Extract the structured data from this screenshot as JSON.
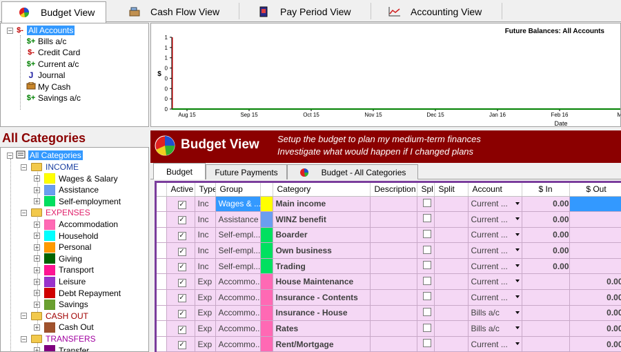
{
  "view_tabs": [
    {
      "label": "Budget View",
      "icon": "pie-chart-icon"
    },
    {
      "label": "Cash Flow View",
      "icon": "cash-register-icon"
    },
    {
      "label": "Pay Period View",
      "icon": "calendar-book-icon"
    },
    {
      "label": "Accounting View",
      "icon": "line-graph-icon"
    }
  ],
  "accounts": {
    "root": {
      "symbol": "$-",
      "label": "All Accounts"
    },
    "items": [
      {
        "symbol": "$+",
        "label": "Bills a/c",
        "color": "#008000"
      },
      {
        "symbol": "$-",
        "label": "Credit Card",
        "color": "#c00000"
      },
      {
        "symbol": "$+",
        "label": "Current a/c",
        "color": "#008000"
      },
      {
        "symbol": "J",
        "label": "Journal",
        "color": "#1a1aa0"
      },
      {
        "symbol": "",
        "label": "My Cash",
        "color": "#8b4513"
      },
      {
        "symbol": "$+",
        "label": "Savings a/c",
        "color": "#008000"
      }
    ]
  },
  "chart": {
    "title": "Future Balances: All Accounts",
    "ylabel": "$",
    "xlabel": "Date"
  },
  "chart_data": {
    "type": "line",
    "title": "Future Balances: All Accounts",
    "xlabel": "Date",
    "ylabel": "$",
    "x_ticks": [
      "Aug 15",
      "Sep 15",
      "Oct 15",
      "Nov 15",
      "Dec 15",
      "Jan 16",
      "Feb 16",
      "M"
    ],
    "y_ticks": [
      "1",
      "1",
      "1",
      "0",
      "0",
      "0",
      "0",
      "0"
    ],
    "series": [
      {
        "values": [
          0,
          0,
          0,
          0,
          0,
          0,
          0,
          0
        ],
        "color": "#008000"
      }
    ],
    "marker_line_color": "#ff0000"
  },
  "categories_title": "All Categories",
  "categories": {
    "root": "All Categories",
    "groups": [
      {
        "label": "INCOME",
        "color": "#1a3fa0",
        "items": [
          {
            "label": "Wages & Salary",
            "color": "#ffff00"
          },
          {
            "label": "Assistance",
            "color": "#6a9ef0"
          },
          {
            "label": "Self-employment",
            "color": "#00e060"
          }
        ]
      },
      {
        "label": "EXPENSES",
        "color": "#e0206a",
        "items": [
          {
            "label": "Accommodation",
            "color": "#ff69b4"
          },
          {
            "label": "Household",
            "color": "#00ffff"
          },
          {
            "label": "Personal",
            "color": "#ff9a00"
          },
          {
            "label": "Giving",
            "color": "#006400"
          },
          {
            "label": "Transport",
            "color": "#ff1493"
          },
          {
            "label": "Leisure",
            "color": "#9932cc"
          },
          {
            "label": "Debt Repayment",
            "color": "#d00000"
          },
          {
            "label": "Savings",
            "color": "#6aa030"
          }
        ]
      },
      {
        "label": "CASH OUT",
        "color": "#a00000",
        "items": [
          {
            "label": "Cash Out",
            "color": "#a0522d"
          }
        ]
      },
      {
        "label": "TRANSFERS",
        "color": "#a000a0",
        "items": [
          {
            "label": "Transfer",
            "color": "#800080"
          }
        ]
      }
    ]
  },
  "budget_header": {
    "title": "Budget View",
    "line1": "Setup the budget to plan my medium-term finances",
    "line2": "Investigate what would happen if I changed plans"
  },
  "sub_tabs": [
    "Budget",
    "Future Payments",
    "Budget - All Categories"
  ],
  "grid": {
    "columns": [
      "Active",
      "Type",
      "Group",
      "",
      "Category",
      "Description",
      "Spl",
      "Split",
      "Account",
      "$ In",
      "$ Out"
    ],
    "rows": [
      {
        "active": true,
        "type": "Inc",
        "group": "Wages & ...",
        "color": "#ffff00",
        "category": "Main income",
        "account": "Current ...",
        "in": "0.00",
        "out": "",
        "selected_in": false,
        "selected_out": true
      },
      {
        "active": true,
        "type": "Inc",
        "group": "Assistance",
        "color": "#6a9ef0",
        "category": "WINZ benefit",
        "account": "Current ...",
        "in": "0.00",
        "out": ""
      },
      {
        "active": true,
        "type": "Inc",
        "group": "Self-empl...",
        "color": "#00e060",
        "category": "Boarder",
        "account": "Current ...",
        "in": "0.00",
        "out": ""
      },
      {
        "active": true,
        "type": "Inc",
        "group": "Self-empl...",
        "color": "#00e060",
        "category": "Own business",
        "account": "Current ...",
        "in": "0.00",
        "out": ""
      },
      {
        "active": true,
        "type": "Inc",
        "group": "Self-empl...",
        "color": "#00e060",
        "category": "Trading",
        "account": "Current ...",
        "in": "0.00",
        "out": ""
      },
      {
        "active": true,
        "type": "Exp",
        "group": "Accommo...",
        "color": "#ff69b4",
        "category": "House Maintenance",
        "account": "Current ...",
        "in": "",
        "out": "0.00"
      },
      {
        "active": true,
        "type": "Exp",
        "group": "Accommo...",
        "color": "#ff69b4",
        "category": "Insurance - Contents",
        "account": "Current ...",
        "in": "",
        "out": "0.00"
      },
      {
        "active": true,
        "type": "Exp",
        "group": "Accommo...",
        "color": "#ff69b4",
        "category": "Insurance - House",
        "account": "Bills a/c",
        "in": "",
        "out": "0.00"
      },
      {
        "active": true,
        "type": "Exp",
        "group": "Accommo...",
        "color": "#ff69b4",
        "category": "Rates",
        "account": "Bills a/c",
        "in": "",
        "out": "0.00"
      },
      {
        "active": true,
        "type": "Exp",
        "group": "Accommo...",
        "color": "#ff69b4",
        "category": "Rent/Mortgage",
        "account": "Current ...",
        "in": "",
        "out": "0.00"
      }
    ]
  }
}
